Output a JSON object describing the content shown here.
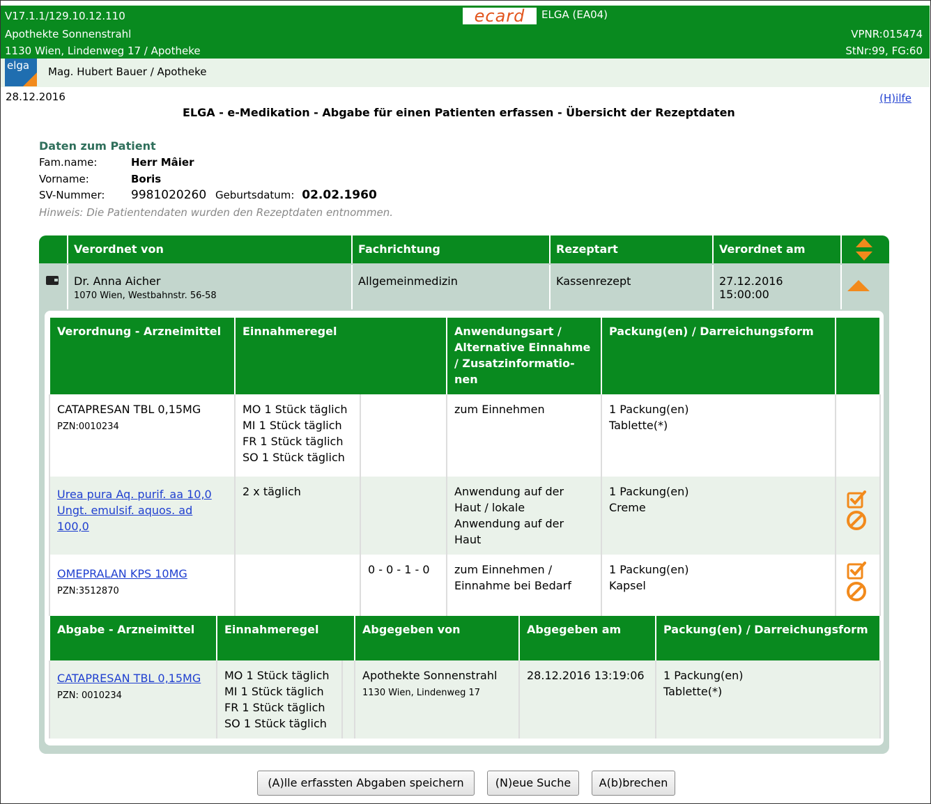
{
  "header": {
    "version": "V17.1.1/129.10.12.110",
    "pharmacy": "Apothekte Sonnenstrahl",
    "address": "1130 Wien, Lindenweg 17 / Apotheke",
    "ecard_logo": "ecard",
    "system": "ELGA (EA04)",
    "vpnr": "VPNR:015474",
    "stnr": "StNr:99, FG:60"
  },
  "userbar": {
    "logo_text": "elga",
    "user": "Mag. Hubert Bauer / Apotheke"
  },
  "date": "28.12.2016",
  "help_link": "(H)ilfe",
  "page_title": "ELGA - e-Medikation - Abgabe für einen Patienten erfassen - Übersicht der Rezeptdaten",
  "patient": {
    "section_title": "Daten zum Patient",
    "famname_label": "Fam.name:",
    "famname": "Herr Mâier",
    "vorname_label": "Vorname:",
    "vorname": "Boris",
    "sv_label": "SV-Nummer:",
    "sv": "9981020260",
    "birth_label": "Geburtsdatum:",
    "birth": "02.02.1960",
    "hint": "Hinweis: Die Patientendaten wurden den Rezeptdaten entnommen."
  },
  "prescription_header": {
    "col1": "Verordnet von",
    "col2": "Fachrichtung",
    "col3": "Rezeptart",
    "col4": "Verordnet am"
  },
  "prescription": {
    "doctor": "Dr. Anna Aicher",
    "doctor_address": "1070 Wien, Westbahnstr. 56-58",
    "specialty": "Allgemeinmedizin",
    "type": "Kassenrezept",
    "date": "27.12.2016",
    "time": "15:00:00"
  },
  "orders": {
    "headers": [
      "Verordnung - Arzneimittel",
      "Einnahmeregel",
      "Anwendungsart / Alternative Einnahme / Zusatzinformatio-nen",
      "Packung(en) / Darreichungsform"
    ],
    "rows": [
      {
        "name": "CATAPRESAN TBL 0,15MG",
        "pzn": "PZN:0010234",
        "rule": [
          "MO 1 Stück täglich",
          "MI 1 Stück täglich",
          "FR 1 Stück täglich",
          "SO 1 Stück täglich"
        ],
        "rule2": "",
        "usage": "zum Einnehmen",
        "pack": "1 Packung(en)",
        "form": "Tablette(*)"
      },
      {
        "name": "Urea pura Aq. purif. aa 10,0 Ungt. emulsif. aquos. ad 100,0",
        "pzn": "",
        "rule": [
          "2 x täglich"
        ],
        "rule2": "",
        "usage": "Anwendung auf der Haut / lokale Anwendung auf der Haut",
        "pack": "1 Packung(en)",
        "form": "Creme"
      },
      {
        "name": "OMEPRALAN KPS 10MG",
        "pzn": "PZN:3512870",
        "rule": [],
        "rule2": "0 - 0 - 1 - 0",
        "usage": "zum Einnehmen / Einnahme bei Bedarf",
        "pack": "1 Packung(en)",
        "form": "Kapsel"
      }
    ]
  },
  "dispense": {
    "headers": [
      "Abgabe - Arzneimittel",
      "Einnahmeregel",
      "Abgegeben von",
      "Abgegeben am",
      "Packung(en) / Darreichungsform"
    ],
    "row": {
      "name": "CATAPRESAN TBL 0,15MG",
      "pzn": "PZN: 0010234",
      "rule": [
        "MO 1 Stück täglich",
        "MI 1 Stück täglich",
        "FR 1 Stück täglich",
        "SO 1 Stück täglich"
      ],
      "by": "Apothekte Sonnenstrahl",
      "by_address": "1130 Wien, Lindenweg 17",
      "at": "28.12.2016 13:19:06",
      "pack": "1 Packung(en)",
      "form": "Tablette(*)"
    }
  },
  "buttons": {
    "save": "(A)lle erfassten Abgaben speichern",
    "new_search": "(N)eue Suche",
    "cancel": "A(b)brechen"
  },
  "colors": {
    "header_green": "#098a1f",
    "accent_orange": "#f28a1c",
    "panel_grey": "#c3d6cd",
    "link_blue": "#1f3fd0"
  }
}
